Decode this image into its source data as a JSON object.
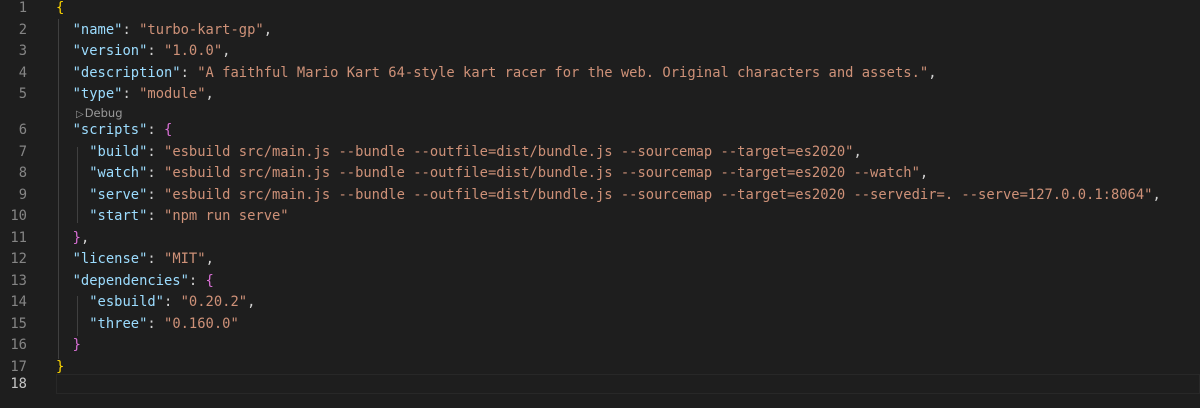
{
  "editor": {
    "active_line": "18",
    "line_numbers": [
      "1",
      "2",
      "3",
      "4",
      "5",
      "6",
      "7",
      "8",
      "9",
      "10",
      "11",
      "12",
      "13",
      "14",
      "15",
      "16",
      "17",
      "18"
    ],
    "codelens": {
      "icon": "play-triangle-icon",
      "label": "Debug"
    },
    "tokens": {
      "name_key": "\"name\"",
      "name_val": "\"turbo-kart-gp\"",
      "version_key": "\"version\"",
      "version_val": "\"1.0.0\"",
      "description_key": "\"description\"",
      "description_val": "\"A faithful Mario Kart 64-style kart racer for the web. Original characters and assets.\"",
      "type_key": "\"type\"",
      "type_val": "\"module\"",
      "scripts_key": "\"scripts\"",
      "build_key": "\"build\"",
      "build_val": "\"esbuild src/main.js --bundle --outfile=dist/bundle.js --sourcemap --target=es2020\"",
      "watch_key": "\"watch\"",
      "watch_val": "\"esbuild src/main.js --bundle --outfile=dist/bundle.js --sourcemap --target=es2020 --watch\"",
      "serve_key": "\"serve\"",
      "serve_val": "\"esbuild src/main.js --bundle --outfile=dist/bundle.js --sourcemap --target=es2020 --servedir=. --serve=127.0.0.1:8064\"",
      "start_key": "\"start\"",
      "start_val": "\"npm run serve\"",
      "license_key": "\"license\"",
      "license_val": "\"MIT\"",
      "dependencies_key": "\"dependencies\"",
      "esbuild_key": "\"esbuild\"",
      "esbuild_val": "\"0.20.2\"",
      "three_key": "\"three\"",
      "three_val": "\"0.160.0\""
    },
    "colors": {
      "background": "#1e1e1e",
      "key": "#9cdcfe",
      "string": "#ce9178",
      "brace_level1": "#ffd700",
      "brace_level2": "#da70d6",
      "line_number": "#858585"
    }
  }
}
